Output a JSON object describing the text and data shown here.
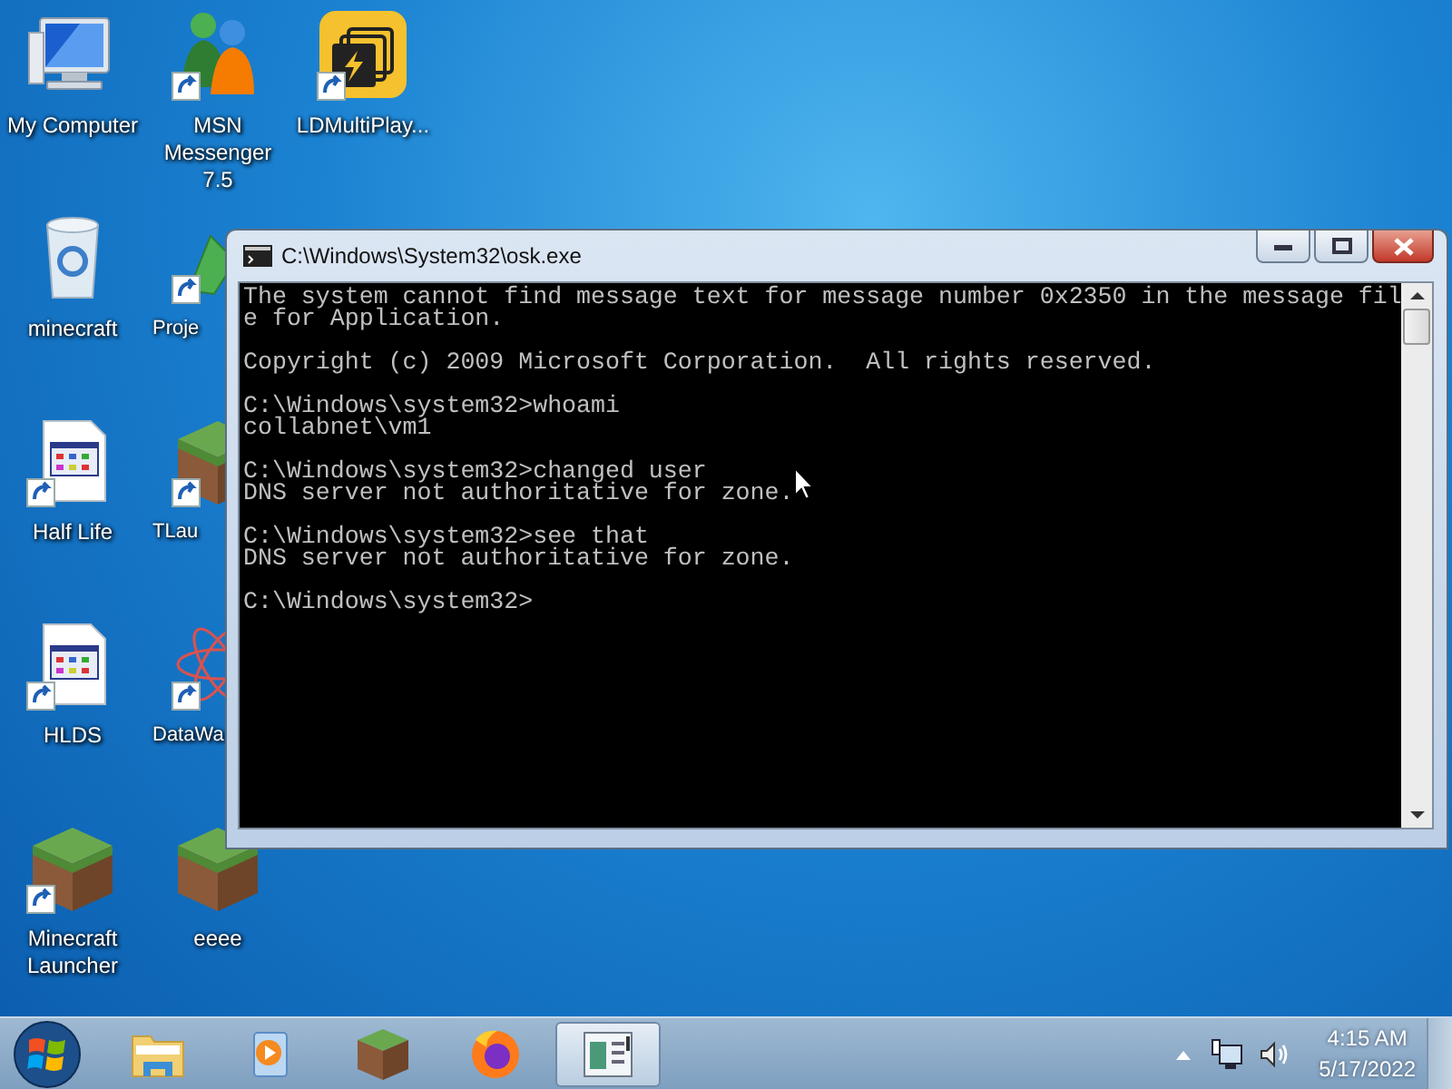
{
  "desktop": {
    "columns": [
      {
        "icons": [
          {
            "kind": "computer",
            "label": "My Computer",
            "shortcut": false
          },
          {
            "kind": "recycle-bin",
            "label": "minecraft",
            "shortcut": false
          },
          {
            "kind": "app-file",
            "label": "Half Life",
            "shortcut": true
          },
          {
            "kind": "app-file",
            "label": "HLDS",
            "shortcut": true
          },
          {
            "kind": "grass-block",
            "label": "Minecraft Launcher",
            "shortcut": true
          }
        ]
      },
      {
        "icons": [
          {
            "kind": "messenger",
            "label": "MSN Messenger 7.5",
            "shortcut": true
          },
          {
            "kind": "arrows",
            "label": "Proje",
            "shortcut": true
          },
          {
            "kind": "grass-block",
            "label": "TLau",
            "shortcut": true
          },
          {
            "kind": "atom",
            "label": "DataWa",
            "shortcut": true
          },
          {
            "kind": "grass-block",
            "label": "eeee",
            "shortcut": false
          }
        ]
      },
      {
        "icons": [
          {
            "kind": "multiplayer",
            "label": "LDMultiPlay...",
            "shortcut": true
          }
        ]
      }
    ]
  },
  "console_window": {
    "title": "C:\\Windows\\System32\\osk.exe",
    "blocks": [
      [
        "The system cannot find message text for message number 0x2350 in the message fil",
        "e for Application."
      ],
      [
        "Copyright (c) 2009 Microsoft Corporation.  All rights reserved."
      ],
      [
        "C:\\Windows\\system32>whoami",
        "collabnet\\vm1"
      ],
      [
        "C:\\Windows\\system32>changed user",
        "DNS server not authoritative for zone."
      ],
      [
        "C:\\Windows\\system32>see that",
        "DNS server not authoritative for zone."
      ],
      [
        "C:\\Windows\\system32>"
      ]
    ]
  },
  "taskbar": {
    "buttons": [
      {
        "kind": "explorer",
        "selected": false
      },
      {
        "kind": "media-player",
        "selected": false
      },
      {
        "kind": "grass-block",
        "selected": false
      },
      {
        "kind": "browser",
        "selected": false
      },
      {
        "kind": "console",
        "selected": true
      }
    ],
    "clock": {
      "time": "4:15 AM",
      "date": "5/17/2022"
    }
  }
}
